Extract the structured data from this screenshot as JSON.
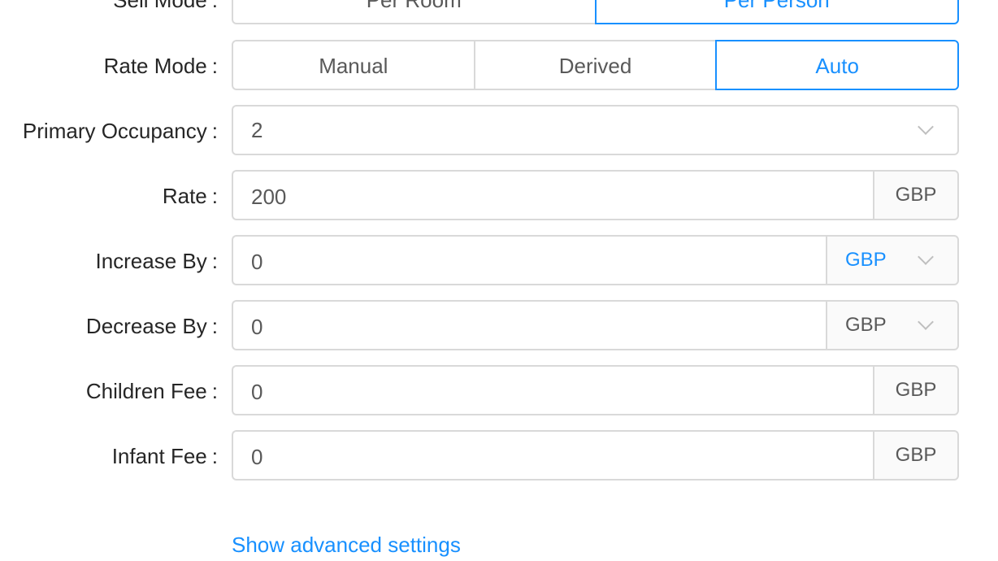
{
  "sell_mode": {
    "label": "Sell Mode",
    "colon": ":",
    "options": [
      "Per Room",
      "Per Person"
    ],
    "selected": "Per Person"
  },
  "rate_mode": {
    "label": "Rate Mode",
    "colon": ":",
    "options": [
      "Manual",
      "Derived",
      "Auto"
    ],
    "selected": "Auto"
  },
  "primary_occupancy": {
    "label": "Primary Occupancy",
    "colon": ":",
    "value": "2",
    "icon": "chevron-down-icon"
  },
  "rate": {
    "label": "Rate",
    "colon": ":",
    "value": "200",
    "currency": "GBP"
  },
  "increase_by": {
    "label": "Increase By",
    "colon": ":",
    "value": "0",
    "unit": "GBP",
    "icon": "chevron-down-icon"
  },
  "decrease_by": {
    "label": "Decrease By",
    "colon": ":",
    "value": "0",
    "unit": "GBP",
    "icon": "chevron-down-icon"
  },
  "children_fee": {
    "label": "Children Fee",
    "colon": ":",
    "value": "0",
    "currency": "GBP"
  },
  "infant_fee": {
    "label": "Infant Fee",
    "colon": ":",
    "value": "0",
    "currency": "GBP"
  },
  "advanced_link": "Show advanced settings",
  "colors": {
    "accent": "#1890ff",
    "border": "#d9d9d9",
    "text": "#262626",
    "muted": "#595959"
  }
}
